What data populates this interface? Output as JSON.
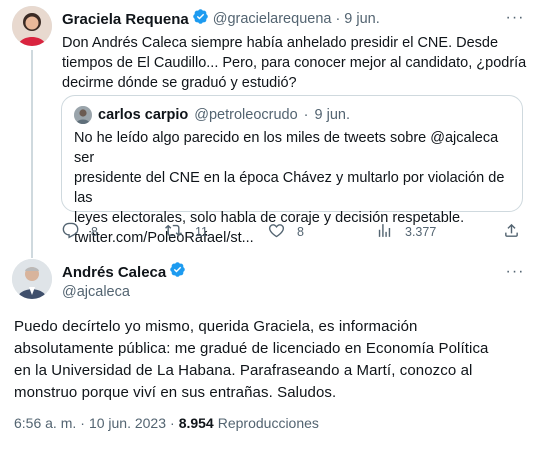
{
  "tweet": {
    "author_name": "Graciela Requena",
    "author_handle": "@gracielarequena",
    "separator": "·",
    "date": "9 jun.",
    "text_lines": [
      "Don Andrés Caleca siempre había anhelado presidir el CNE. Desde",
      "tiempos de El Caudillo... Pero, para conocer mejor al candidato, ¿podría",
      "decirme dónde se graduó y estudió?"
    ],
    "quote": {
      "author_name": "carlos carpio",
      "author_handle": "@petroleocrudo",
      "separator": "·",
      "date": "9 jun.",
      "text_lines": [
        "No he leído algo parecido en los miles de tweets sobre @ajcaleca ser",
        "presidente del CNE en la época Chávez y multarlo por violación de las",
        "leyes electorales, solo habla de coraje y decisión respetable.",
        "twitter.com/PoleoRafael/st..."
      ]
    },
    "actions": {
      "replies": "8",
      "retweets": "11",
      "likes": "8",
      "views": "3.377"
    }
  },
  "reply": {
    "author_name": "Andrés Caleca",
    "author_handle": "@ajcaleca",
    "text_lines": [
      "Puedo decírtelo yo mismo, querida Graciela, es información",
      "absolutamente pública: me gradué de licenciado en Economía Política",
      "en la Universidad de La Habana. Parafraseando a Martí, conozco al",
      "monstruo porque viví en sus entrañas. Saludos."
    ],
    "time": "6:56 a. m.",
    "separator": "·",
    "date": "10 jun. 2023",
    "separator2": "·",
    "views_count": "8.954",
    "views_label": "Reproducciones"
  },
  "colors": {
    "verified": "#1d9bf0",
    "text_primary": "#0f1419",
    "text_secondary": "#536471",
    "border": "#cfd9de"
  },
  "icons": {
    "more": "more-icon",
    "verified": "verified-badge-icon",
    "reply": "reply-icon",
    "retweet": "retweet-icon",
    "like": "heart-icon",
    "views": "views-icon",
    "share": "share-icon"
  }
}
